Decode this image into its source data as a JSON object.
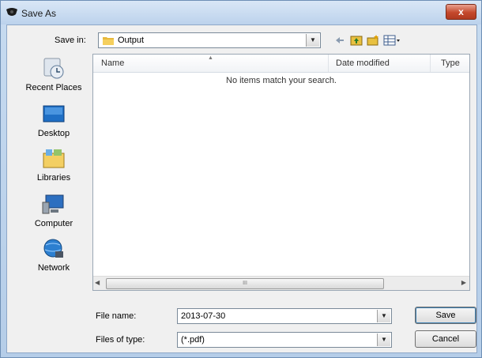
{
  "window": {
    "title": "Save As",
    "close_glyph": "x"
  },
  "toolbar": {
    "save_in_label": "Save in:",
    "save_in_value": "Output",
    "icons": [
      "back-arrow-icon",
      "up-folder-icon",
      "new-folder-icon",
      "views-menu-icon"
    ]
  },
  "places": [
    {
      "label": "Recent Places",
      "icon": "recent-places-icon"
    },
    {
      "label": "Desktop",
      "icon": "desktop-icon"
    },
    {
      "label": "Libraries",
      "icon": "libraries-icon"
    },
    {
      "label": "Computer",
      "icon": "computer-icon"
    },
    {
      "label": "Network",
      "icon": "network-icon"
    }
  ],
  "file_list": {
    "columns": [
      "Name",
      "Date modified",
      "Type"
    ],
    "empty_message": "No items match your search.",
    "scroll_grip": "III"
  },
  "form": {
    "file_name_label": "File name:",
    "file_name_value": "2013-07-30",
    "file_type_label": "Files of type:",
    "file_type_value": "(*.pdf)"
  },
  "buttons": {
    "save": "Save",
    "cancel": "Cancel"
  }
}
